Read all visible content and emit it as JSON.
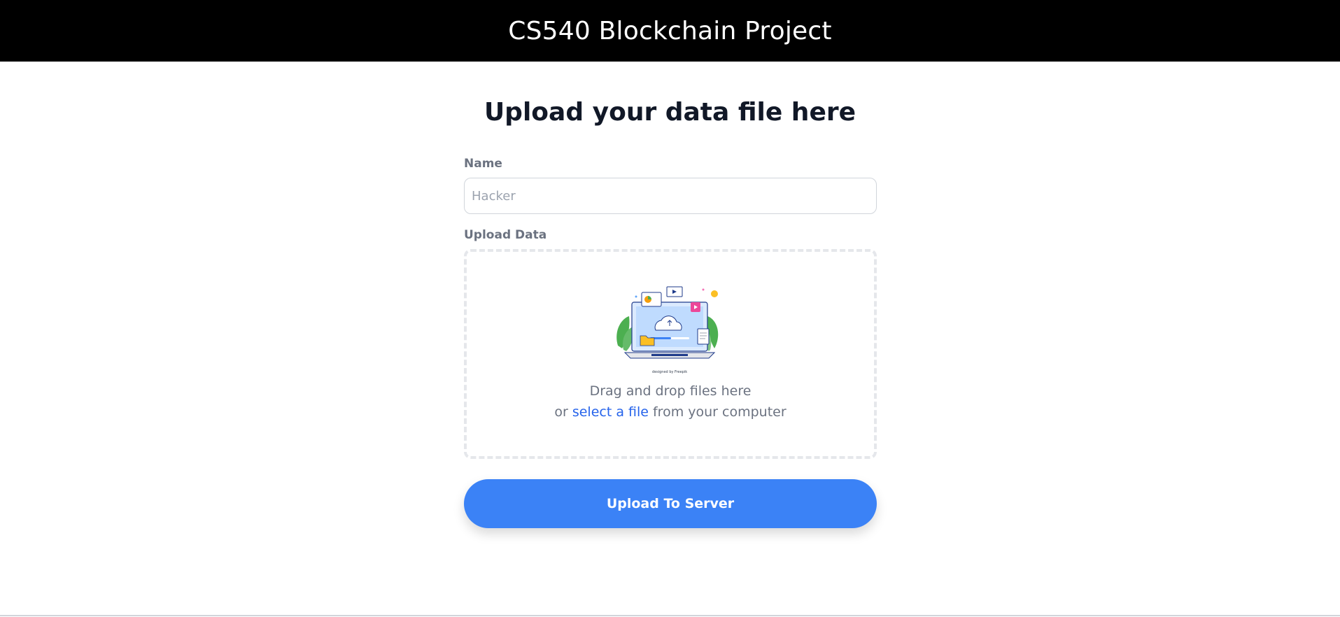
{
  "header": {
    "title": "CS540 Blockchain Project"
  },
  "main": {
    "heading": "Upload your data file here",
    "name_field": {
      "label": "Name",
      "placeholder": "Hacker",
      "value": ""
    },
    "upload_field": {
      "label": "Upload Data",
      "illustration_credit": "designed by Freepik",
      "drag_text": "Drag and drop files here",
      "or_text": "or ",
      "link_text": "select a file",
      "suffix_text": " from your computer"
    },
    "submit_button": {
      "label": "Upload To Server"
    }
  },
  "colors": {
    "header_bg": "#000000",
    "accent": "#3b82f6",
    "link": "#2563eb",
    "label": "#6b7280",
    "dropzone_border": "#e5e7eb"
  },
  "icons": {
    "illustration": "cloud-upload-illustration"
  }
}
